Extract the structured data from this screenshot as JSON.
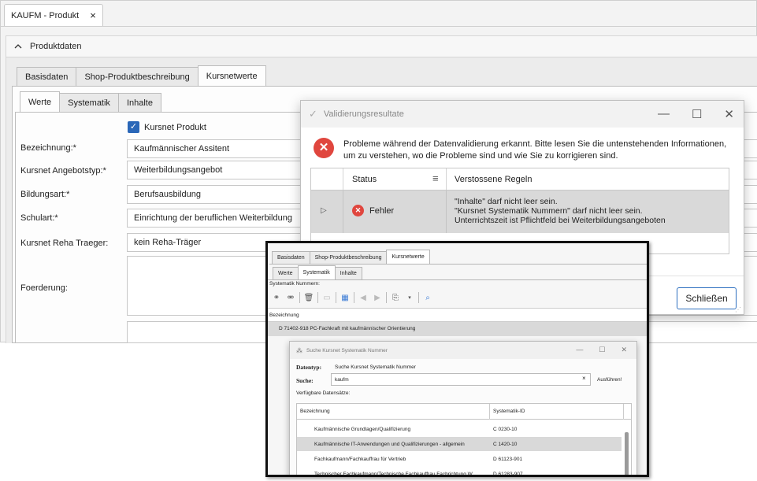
{
  "doc_tab": {
    "title": "KAUFM - Produkt",
    "close": "×"
  },
  "section": {
    "chevron": "^",
    "title": "Produktdaten"
  },
  "outer_tabs": [
    "Basisdaten",
    "Shop-Produktbeschreibung",
    "Kursnetwerte"
  ],
  "inner_tabs": [
    "Werte",
    "Systematik",
    "Inhalte"
  ],
  "form": {
    "checkbox_label": "Kursnet Produkt",
    "fields": [
      {
        "label": "Bezeichnung:*",
        "value": "Kaufmännischer Assitent"
      },
      {
        "label": "Kursnet Angebotstyp:*",
        "value": "Weiterbildungsangebot"
      },
      {
        "label": "Bildungsart:*",
        "value": "Berufsausbildung"
      },
      {
        "label": "Schulart:*",
        "value": "Einrichtung der beruflichen Weiterbildung"
      },
      {
        "label": "Kursnet Reha Traeger:",
        "value": "kein Reha-Träger"
      }
    ],
    "foerderung_label": "Foerderung:"
  },
  "validation": {
    "title": "Validierungsresultate",
    "message": "Probleme während der Datenvalidierung erkannt. Bitte lesen Sie die untenstehenden Informationen, um zu verstehen, wo die Probleme sind und wie Sie zu korrigieren sind.",
    "col_status": "Status",
    "col_rules": "Verstossene Regeln",
    "row": {
      "status": "Fehler",
      "rules": [
        "\"Inhalte\" darf nicht leer sein.",
        "\"Kursnet Systematik Nummern\" darf nicht leer sein.",
        "Unterrichtszeit ist Pflichtfeld bei Weiterbildungsangeboten"
      ]
    },
    "close_label": "Schließen"
  },
  "inset": {
    "outer_tabs": [
      "Basisdaten",
      "Shop-Produktbeschreibung",
      "Kursnetwerte"
    ],
    "inner_tabs": [
      "Werte",
      "Systematik",
      "Inhalte"
    ],
    "section_label": "Systematik Nummern:",
    "col_label": "Bezeichnung",
    "selected_row": "D 71402-918 PC-Fachkraft mit kaufmännischer Orientierung",
    "search_dialog": {
      "title": "Suche Kursnet Systematik Nummer",
      "datentyp_label": "Datentyp:",
      "datentyp_value": "Suche Kursnet Systematik Nummer",
      "suche_label": "Suche:",
      "suche_value": "kaufm",
      "clear": "×",
      "execute": "Ausführen!",
      "available": "Verfügbare Datensätze:",
      "col_name": "Bezeichnung",
      "col_id": "Systematik-ID",
      "rows": [
        {
          "name": "Kaufmännische Grundlagen/Qualifizierung",
          "id": "C 0230-10"
        },
        {
          "name": "Kaufmännische IT-Anwendungen und Qualifizierungen - allgemein",
          "id": "C 1420-10"
        },
        {
          "name": "Fachkaufmann/Fachkauffrau für Vertrieb",
          "id": "D 61123-901"
        },
        {
          "name": "Technischer Fachkaufmann/Technische Fachkauffrau Fachrichtung W...",
          "id": "D 61283-907"
        }
      ]
    }
  },
  "colors": {
    "accent": "#2a67b8",
    "error": "#e0463e",
    "selected_row": "#d9d9d9"
  }
}
